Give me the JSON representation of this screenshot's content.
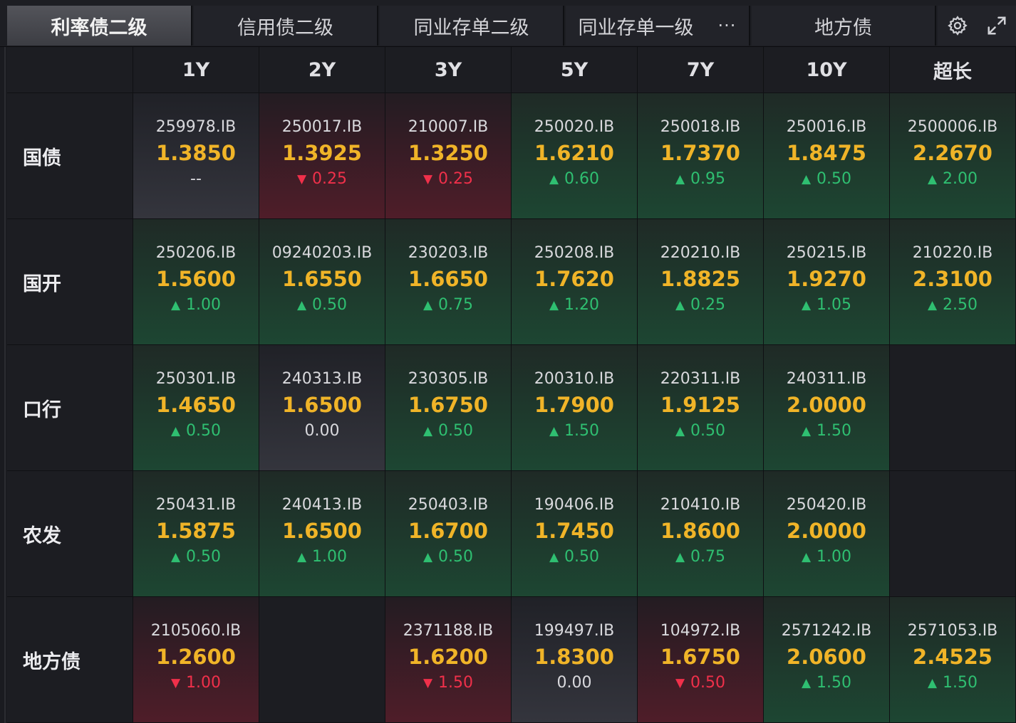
{
  "tabs": [
    {
      "label": "利率债二级",
      "active": true
    },
    {
      "label": "信用债二级",
      "active": false
    },
    {
      "label": "同业存单二级",
      "active": false
    },
    {
      "label": "同业存单一级",
      "active": false,
      "more": "···"
    },
    {
      "label": "地方债",
      "active": false
    }
  ],
  "toolbar": {
    "settings_icon": "gear-icon",
    "expand_icon": "expand-icon"
  },
  "colors": {
    "yield": "#f0b428",
    "up": "#2fbf71",
    "down": "#f0304a",
    "neutral": "#d9d9dd"
  },
  "tenors": [
    "1Y",
    "2Y",
    "3Y",
    "5Y",
    "7Y",
    "10Y",
    "超长"
  ],
  "rows": [
    {
      "name": "国债",
      "cells": [
        {
          "code": "259978.IB",
          "yield": "1.3850",
          "change": "--",
          "dir": "flat"
        },
        {
          "code": "250017.IB",
          "yield": "1.3925",
          "change": "0.25",
          "dir": "down"
        },
        {
          "code": "210007.IB",
          "yield": "1.3250",
          "change": "0.25",
          "dir": "down"
        },
        {
          "code": "250020.IB",
          "yield": "1.6210",
          "change": "0.60",
          "dir": "up"
        },
        {
          "code": "250018.IB",
          "yield": "1.7370",
          "change": "0.95",
          "dir": "up"
        },
        {
          "code": "250016.IB",
          "yield": "1.8475",
          "change": "0.50",
          "dir": "up"
        },
        {
          "code": "2500006.IB",
          "yield": "2.2670",
          "change": "2.00",
          "dir": "up"
        }
      ]
    },
    {
      "name": "国开",
      "cells": [
        {
          "code": "250206.IB",
          "yield": "1.5600",
          "change": "1.00",
          "dir": "up"
        },
        {
          "code": "09240203.IB",
          "yield": "1.6550",
          "change": "0.50",
          "dir": "up"
        },
        {
          "code": "230203.IB",
          "yield": "1.6650",
          "change": "0.75",
          "dir": "up"
        },
        {
          "code": "250208.IB",
          "yield": "1.7620",
          "change": "1.20",
          "dir": "up"
        },
        {
          "code": "220210.IB",
          "yield": "1.8825",
          "change": "0.25",
          "dir": "up"
        },
        {
          "code": "250215.IB",
          "yield": "1.9270",
          "change": "1.05",
          "dir": "up"
        },
        {
          "code": "210220.IB",
          "yield": "2.3100",
          "change": "2.50",
          "dir": "up"
        }
      ]
    },
    {
      "name": "口行",
      "cells": [
        {
          "code": "250301.IB",
          "yield": "1.4650",
          "change": "0.50",
          "dir": "up"
        },
        {
          "code": "240313.IB",
          "yield": "1.6500",
          "change": "0.00",
          "dir": "flat"
        },
        {
          "code": "230305.IB",
          "yield": "1.6750",
          "change": "0.50",
          "dir": "up"
        },
        {
          "code": "200310.IB",
          "yield": "1.7900",
          "change": "1.50",
          "dir": "up"
        },
        {
          "code": "220311.IB",
          "yield": "1.9125",
          "change": "0.50",
          "dir": "up"
        },
        {
          "code": "240311.IB",
          "yield": "2.0000",
          "change": "1.50",
          "dir": "up"
        },
        null
      ]
    },
    {
      "name": "农发",
      "cells": [
        {
          "code": "250431.IB",
          "yield": "1.5875",
          "change": "0.50",
          "dir": "up"
        },
        {
          "code": "240413.IB",
          "yield": "1.6500",
          "change": "1.00",
          "dir": "up"
        },
        {
          "code": "250403.IB",
          "yield": "1.6700",
          "change": "0.50",
          "dir": "up"
        },
        {
          "code": "190406.IB",
          "yield": "1.7450",
          "change": "0.50",
          "dir": "up"
        },
        {
          "code": "210410.IB",
          "yield": "1.8600",
          "change": "0.75",
          "dir": "up"
        },
        {
          "code": "250420.IB",
          "yield": "2.0000",
          "change": "1.00",
          "dir": "up"
        },
        null
      ]
    },
    {
      "name": "地方债",
      "cells": [
        {
          "code": "2105060.IB",
          "yield": "1.2600",
          "change": "1.00",
          "dir": "down"
        },
        null,
        {
          "code": "2371188.IB",
          "yield": "1.6200",
          "change": "1.50",
          "dir": "down"
        },
        {
          "code": "199497.IB",
          "yield": "1.8300",
          "change": "0.00",
          "dir": "flat"
        },
        {
          "code": "104972.IB",
          "yield": "1.6750",
          "change": "0.50",
          "dir": "down"
        },
        {
          "code": "2571242.IB",
          "yield": "2.0600",
          "change": "1.50",
          "dir": "up"
        },
        {
          "code": "2571053.IB",
          "yield": "2.4525",
          "change": "1.50",
          "dir": "up"
        }
      ]
    }
  ]
}
